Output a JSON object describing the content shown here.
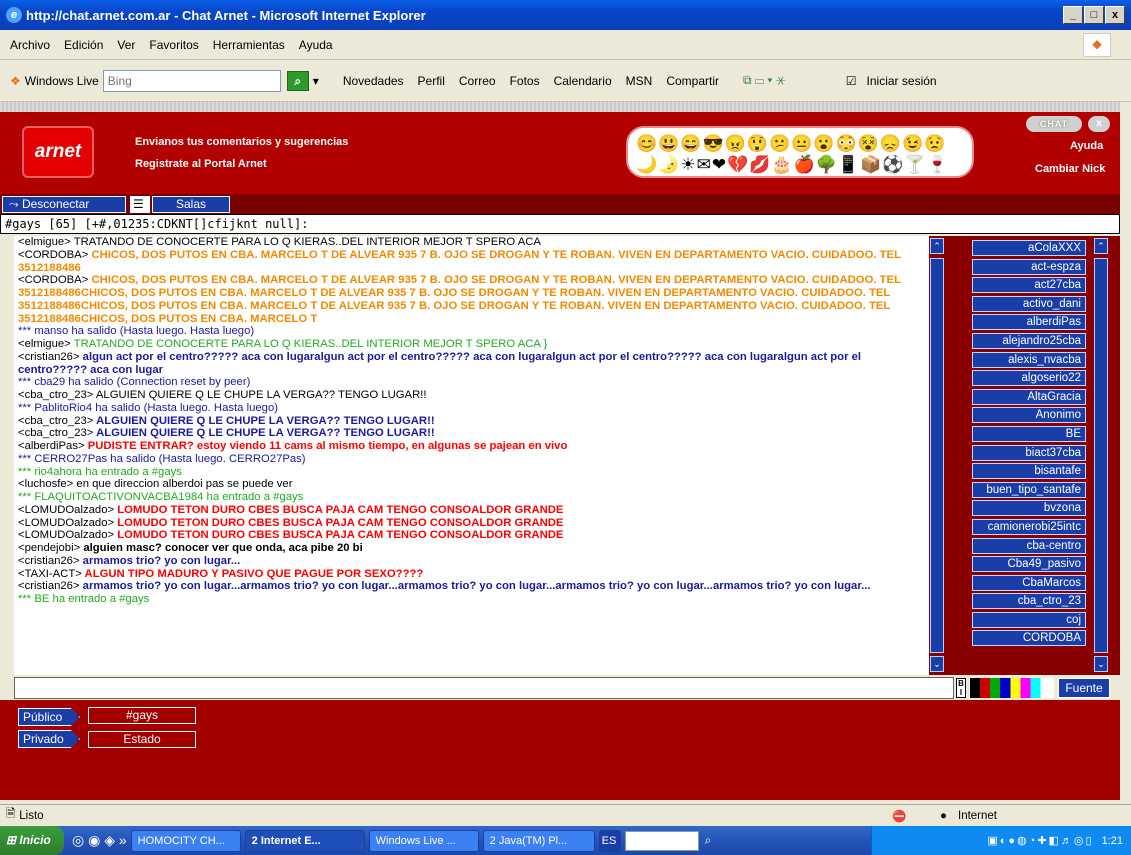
{
  "window": {
    "title": "http://chat.arnet.com.ar - Chat Arnet - Microsoft Internet Explorer",
    "buttons": [
      "_",
      "□",
      "x"
    ]
  },
  "menu": [
    "Archivo",
    "Edición",
    "Ver",
    "Favoritos",
    "Herramientas",
    "Ayuda"
  ],
  "toolbar": {
    "windows_live": "Windows Live",
    "search_placeholder": "Bing",
    "items": [
      "Novedades",
      "Perfil",
      "Correo",
      "Fotos",
      "Calendario",
      "MSN",
      "Compartir"
    ],
    "signin": "Iniciar sesión"
  },
  "header": {
    "logo": "arnet",
    "link1": "Envianos tus comentarios y sugerencias",
    "link2": "Registrate al Portal Arnet",
    "ayuda": "Ayuda",
    "cambiar": "Cambiar Nick",
    "chat_btn": "CHAT",
    "close_btn": "x",
    "emoticons_row1": "😊😃😄😎😠😲😕😐😮😳😵😞😉😟",
    "emoticons_row2": "🌙🌛☀✉❤💔💋🎂🍎🌳📱📦⚽🍸🍷"
  },
  "nav": {
    "disconnect": "Desconectar",
    "rooms": "Salas"
  },
  "channel_bar": "#gays [65] [+#,01235:CDKNT[]cfijknt null]:",
  "chat_lines": [
    {
      "nick": "<elmigue>",
      "text": " TRATANDO DE CONOCERTE PARA LO Q  KIERAS..DEL INTERIOR MEJOR T SPERO ACA",
      "cls": "c-gray"
    },
    {
      "nick": "<CORDOBA>",
      "text": " CHICOS, DOS PUTOS EN CBA. MARCELO T DE ALVEAR 935 7 B. OJO SE DROGAN Y TE ROBAN. VIVEN EN DEPARTAMENTO VACIO. CUIDADOO. TEL 3512188486",
      "cls": "c-orange"
    },
    {
      "nick": "<CORDOBA>",
      "text": " CHICOS, DOS PUTOS EN CBA. MARCELO T DE ALVEAR 935 7 B. OJO SE DROGAN Y TE ROBAN. VIVEN EN DEPARTAMENTO VACIO. CUIDADOO. TEL 3512188486CHICOS, DOS PUTOS EN CBA. MARCELO T DE ALVEAR 935 7 B. OJO SE DROGAN Y TE ROBAN. VIVEN EN DEPARTAMENTO VACIO. CUIDADOO. TEL 3512188486CHICOS, DOS PUTOS EN CBA. MARCELO T DE ALVEAR 935 7 B. OJO SE DROGAN Y TE ROBAN. VIVEN EN DEPARTAMENTO VACIO. CUIDADOO. TEL 3512188486CHICOS, DOS PUTOS EN CBA. MARCELO T",
      "cls": "c-orange"
    },
    {
      "nick": "",
      "text": "*** manso ha salido (Hasta luego.  Hasta luego)",
      "cls": "c-navy"
    },
    {
      "nick": "<elmigue>",
      "text": " TRATANDO DE CONOCERTE PARA LO Q  KIERAS..DEL INTERIOR MEJOR T SPERO ACA }",
      "cls": "c-green"
    },
    {
      "nick": "<cristian26>",
      "text": " algun act por el centro????? aca con lugaralgun act por el centro????? aca con lugaralgun act por el centro????? aca con lugaralgun act por el centro????? aca con lugar",
      "cls": "c-blue"
    },
    {
      "nick": "",
      "text": "*** cba29 ha salido (Connection reset by peer)",
      "cls": "c-navy"
    },
    {
      "nick": "<cba_ctro_23>",
      "text": " ALGUIEN QUIERE Q LE CHUPE LA VERGA?? TENGO LUGAR!!",
      "cls": "c-gray"
    },
    {
      "nick": "",
      "text": "*** PablitoRio4 ha salido (Hasta luego.  Hasta luego)",
      "cls": "c-navy"
    },
    {
      "nick": "<cba_ctro_23>",
      "text": " ALGUIEN QUIERE Q LE CHUPE LA VERGA?? TENGO LUGAR!!",
      "cls": "c-blue"
    },
    {
      "nick": "<cba_ctro_23>",
      "text": " ALGUIEN QUIERE Q LE CHUPE LA VERGA?? TENGO LUGAR!!",
      "cls": "c-blue"
    },
    {
      "nick": "<alberdiPas>",
      "text": " PUDISTE ENTRAR? estoy viendo 11 cams al mismo tiempo, en algunas se pajean en vivo",
      "cls": "c-red"
    },
    {
      "nick": "",
      "text": "*** CERRO27Pas ha salido (Hasta luego.  CERRO27Pas)",
      "cls": "c-navy"
    },
    {
      "nick": "",
      "text": "*** rio4ahora ha entrado a #gays",
      "cls": "c-green"
    },
    {
      "nick": "<luchosfe>",
      "text": " en que direccion alberdoi pas se puede ver",
      "cls": "c-gray"
    },
    {
      "nick": "",
      "text": "*** FLAQUITOACTIVONVACBA1984 ha entrado a #gays",
      "cls": "c-green"
    },
    {
      "nick": "<LOMUDOalzado>",
      "text": " LOMUDO TETON DURO CBES BUSCA PAJA CAM TENGO CONSOALDOR GRANDE",
      "cls": "c-red"
    },
    {
      "nick": "<LOMUDOalzado>",
      "text": " LOMUDO TETON DURO CBES BUSCA PAJA CAM TENGO CONSOALDOR GRANDE",
      "cls": "c-red"
    },
    {
      "nick": "<LOMUDOalzado>",
      "text": " LOMUDO TETON DURO CBES BUSCA PAJA CAM TENGO CONSOALDOR GRANDE",
      "cls": "c-red"
    },
    {
      "nick": "<pendejobi>",
      "text": " alguien masc? conocer ver que onda, aca pibe 20 bi",
      "cls": "c-black"
    },
    {
      "nick": "<cristian26>",
      "text": " armamos trio? yo con lugar...",
      "cls": "c-blue"
    },
    {
      "nick": "<TAXI-ACT>",
      "text": " ALGUN TIPO MADURO Y PASIVO QUE PAGUE POR SEXO????",
      "cls": "c-red"
    },
    {
      "nick": "<cristian26>",
      "text": " armamos trio? yo con lugar...armamos trio? yo con lugar...armamos trio? yo con lugar...armamos trio? yo con lugar...armamos trio? yo con lugar...",
      "cls": "c-blue"
    },
    {
      "nick": "",
      "text": "*** BE ha entrado a #gays",
      "cls": "c-green"
    }
  ],
  "users": [
    "aColaXXX",
    "act-espza",
    "act27cba",
    "activo_dani",
    "alberdiPas",
    "alejandro25cba",
    "alexis_nvacba",
    "algoserio22",
    "AltaGracia",
    "Anonimo",
    "BE",
    "biact37cba",
    "bisantafe",
    "buen_tipo_santafe",
    "bvzona",
    "camionerobi25intc",
    "cba-centro",
    "Cba49_pasivo",
    "CbaMarcos",
    "cba_ctro_23",
    "coj",
    "CORDOBA"
  ],
  "fuente": "Fuente",
  "bottom": {
    "publico": "Público",
    "channel": "#gays",
    "privado": "Privado",
    "estado": "Estado"
  },
  "status": {
    "text": "Listo",
    "zone": "Internet"
  },
  "taskbar": {
    "start": "Inicio",
    "tasks": [
      "HOMOCITY CH...",
      "2 Internet E...",
      "Windows Live ...",
      "2 Java(TM) Pl..."
    ],
    "lang": "ES",
    "time": "1:21"
  }
}
